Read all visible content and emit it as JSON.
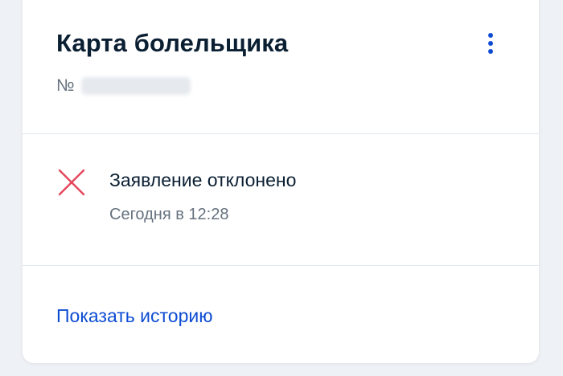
{
  "card": {
    "title": "Карта болельщика",
    "number_prefix": "№",
    "menu_icon": "more-vertical-icon"
  },
  "status": {
    "icon": "cross-icon",
    "text": "Заявление отклонено",
    "time": "Сегодня в 12:28"
  },
  "actions": {
    "history_label": "Показать историю"
  },
  "colors": {
    "title": "#0b1f33",
    "secondary_text": "#66727f",
    "link": "#0d4cd3",
    "error": "#e5455b",
    "divider": "#e3e7ee",
    "background": "#eef1f5",
    "card": "#ffffff"
  }
}
